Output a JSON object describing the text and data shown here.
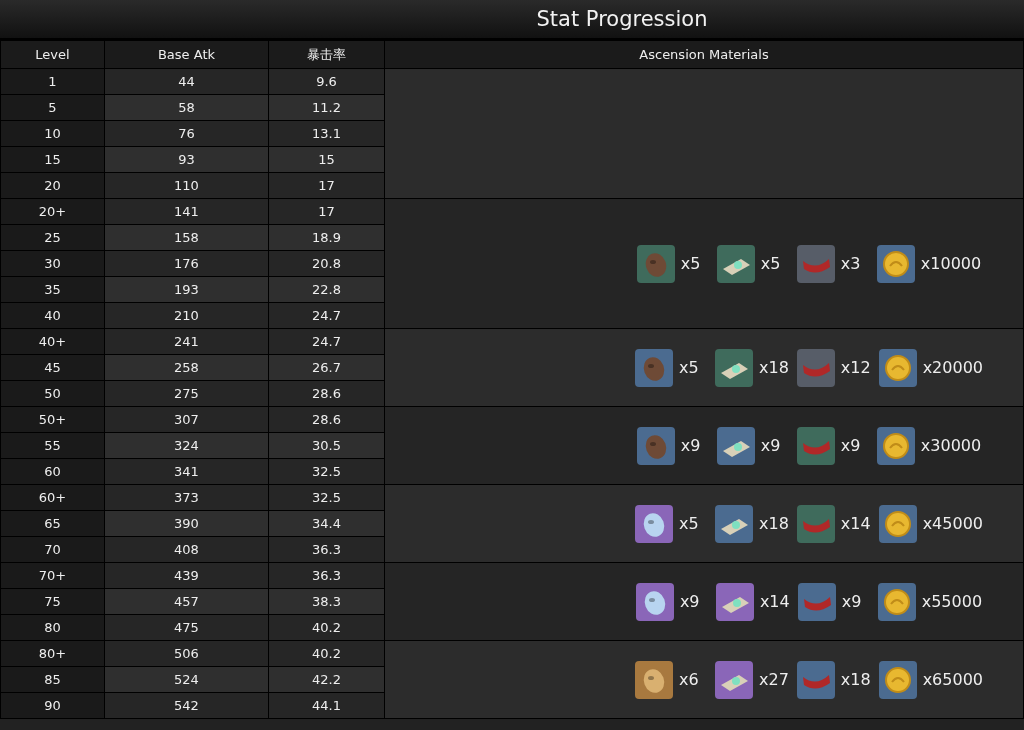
{
  "title": "Stat Progression",
  "columns": [
    "Level",
    "Base Atk",
    "暴击率",
    "Ascension Materials"
  ],
  "groups": [
    {
      "rows": [
        {
          "level": "1",
          "base_atk": "44",
          "crit_rate": "9.6"
        },
        {
          "level": "5",
          "base_atk": "58",
          "crit_rate": "11.2"
        },
        {
          "level": "10",
          "base_atk": "76",
          "crit_rate": "13.1"
        },
        {
          "level": "15",
          "base_atk": "93",
          "crit_rate": "15"
        },
        {
          "level": "20",
          "base_atk": "110",
          "crit_rate": "17"
        }
      ]
    },
    {
      "rows": [
        {
          "level": "20+",
          "base_atk": "141",
          "crit_rate": "17"
        },
        {
          "level": "25",
          "base_atk": "158",
          "crit_rate": "18.9"
        },
        {
          "level": "30",
          "base_atk": "176",
          "crit_rate": "20.8"
        },
        {
          "level": "35",
          "base_atk": "193",
          "crit_rate": "22.8"
        },
        {
          "level": "40",
          "base_atk": "210",
          "crit_rate": "24.7"
        }
      ],
      "materials": [
        {
          "kind": "mask",
          "color": "#3f6b5c",
          "count": "x5"
        },
        {
          "kind": "scroll",
          "color": "#3f6b5c",
          "count": "x5"
        },
        {
          "kind": "sash",
          "color": "#575d68",
          "count": "x3"
        },
        {
          "kind": "coin",
          "color": "#4b6b90",
          "count": "x10000"
        }
      ]
    },
    {
      "rows": [
        {
          "level": "40+",
          "base_atk": "241",
          "crit_rate": "24.7"
        },
        {
          "level": "45",
          "base_atk": "258",
          "crit_rate": "26.7"
        },
        {
          "level": "50",
          "base_atk": "275",
          "crit_rate": "28.6"
        }
      ],
      "materials": [
        {
          "kind": "mask",
          "color": "#4b6b90",
          "count": "x5"
        },
        {
          "kind": "scroll",
          "color": "#3f6b5c",
          "count": "x18"
        },
        {
          "kind": "sash",
          "color": "#575d68",
          "count": "x12"
        },
        {
          "kind": "coin",
          "color": "#4b6b90",
          "count": "x20000"
        }
      ]
    },
    {
      "rows": [
        {
          "level": "50+",
          "base_atk": "307",
          "crit_rate": "28.6"
        },
        {
          "level": "55",
          "base_atk": "324",
          "crit_rate": "30.5"
        },
        {
          "level": "60",
          "base_atk": "341",
          "crit_rate": "32.5"
        }
      ],
      "materials": [
        {
          "kind": "mask",
          "color": "#4b6b90",
          "count": "x9"
        },
        {
          "kind": "scroll",
          "color": "#4b6b90",
          "count": "x9"
        },
        {
          "kind": "sash",
          "color": "#3f6b5c",
          "count": "x9"
        },
        {
          "kind": "coin",
          "color": "#4b6b90",
          "count": "x30000"
        }
      ]
    },
    {
      "rows": [
        {
          "level": "60+",
          "base_atk": "373",
          "crit_rate": "32.5"
        },
        {
          "level": "65",
          "base_atk": "390",
          "crit_rate": "34.4"
        },
        {
          "level": "70",
          "base_atk": "408",
          "crit_rate": "36.3"
        }
      ],
      "materials": [
        {
          "kind": "mask",
          "color": "#8a66b8",
          "count": "x5"
        },
        {
          "kind": "scroll",
          "color": "#4b6b90",
          "count": "x18"
        },
        {
          "kind": "sash",
          "color": "#3f6b5c",
          "count": "x14"
        },
        {
          "kind": "coin",
          "color": "#4b6b90",
          "count": "x45000"
        }
      ]
    },
    {
      "rows": [
        {
          "level": "70+",
          "base_atk": "439",
          "crit_rate": "36.3"
        },
        {
          "level": "75",
          "base_atk": "457",
          "crit_rate": "38.3"
        },
        {
          "level": "80",
          "base_atk": "475",
          "crit_rate": "40.2"
        }
      ],
      "materials": [
        {
          "kind": "mask",
          "color": "#8a66b8",
          "count": "x9"
        },
        {
          "kind": "scroll",
          "color": "#8a66b8",
          "count": "x14"
        },
        {
          "kind": "sash",
          "color": "#4b6b90",
          "count": "x9"
        },
        {
          "kind": "coin",
          "color": "#4b6b90",
          "count": "x55000"
        }
      ]
    },
    {
      "rows": [
        {
          "level": "80+",
          "base_atk": "506",
          "crit_rate": "40.2"
        },
        {
          "level": "85",
          "base_atk": "524",
          "crit_rate": "42.2"
        },
        {
          "level": "90",
          "base_atk": "542",
          "crit_rate": "44.1"
        }
      ],
      "materials": [
        {
          "kind": "mask",
          "color": "#a8793f",
          "count": "x6"
        },
        {
          "kind": "scroll",
          "color": "#8a66b8",
          "count": "x27"
        },
        {
          "kind": "sash",
          "color": "#4b6b90",
          "count": "x18"
        },
        {
          "kind": "coin",
          "color": "#4b6b90",
          "count": "x65000"
        }
      ]
    }
  ]
}
